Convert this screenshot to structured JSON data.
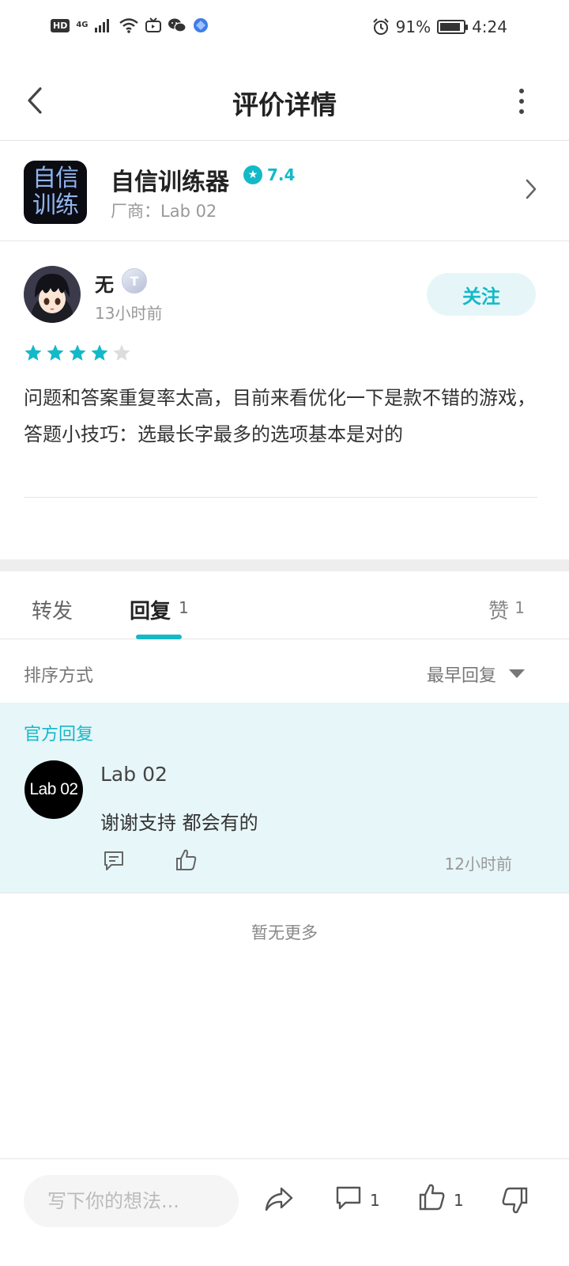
{
  "status_bar": {
    "network": "4G",
    "battery_percent": "91%",
    "battery_level": 0.91,
    "time": "4:24",
    "icons": [
      "hd-icon",
      "signal-icon",
      "wifi-icon",
      "tv-app-icon",
      "wechat-icon",
      "browser-icon",
      "alarm-icon",
      "battery-icon"
    ]
  },
  "header": {
    "title": "评价详情"
  },
  "app": {
    "icon_text_line1": "自信",
    "icon_text_line2": "训练",
    "name": "自信训练器",
    "rating": "7.4",
    "vendor": "厂商：Lab 02"
  },
  "review": {
    "user_name": "无",
    "level_badge": "T",
    "time_ago": "13小时前",
    "follow_label": "关注",
    "stars_filled": 4,
    "stars_total": 5,
    "text": "问题和答案重复率太高，目前来看优化一下是款不错的游戏，答题小技巧：选最长字最多的选项基本是对的"
  },
  "tabs": {
    "forward_label": "转发",
    "reply_label": "回复",
    "reply_count": "1",
    "like_label": "赞",
    "like_count": "1"
  },
  "sort": {
    "label": "排序方式",
    "value": "最早回复"
  },
  "official_reply": {
    "section_label": "官方回复",
    "avatar_text": "Lab 02",
    "author": "Lab 02",
    "text": "谢谢支持 都会有的",
    "time_ago": "12小时前"
  },
  "no_more": "暂无更多",
  "bottom_bar": {
    "input_placeholder": "写下你的想法...",
    "comment_count": "1",
    "like_count": "1"
  },
  "colors": {
    "accent": "#14b9c8",
    "official_bg": "#e7f6f9",
    "star_empty": "#dddddd"
  }
}
